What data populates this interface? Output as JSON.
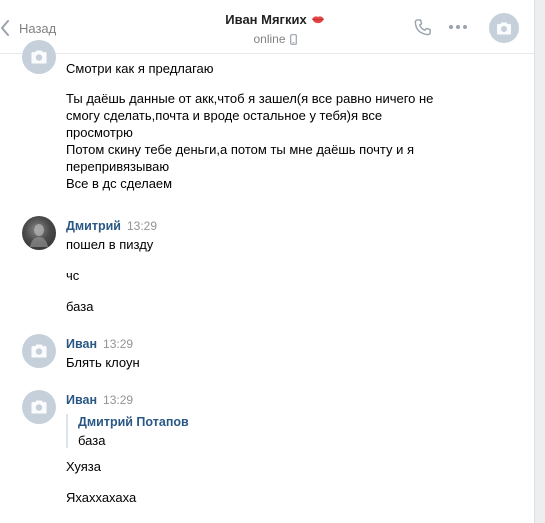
{
  "header": {
    "back_label": "Назад",
    "title": "Иван Мягких",
    "status": "online"
  },
  "messages": [
    {
      "lines": [
        "Смотри как я предлагаю",
        "Ты даёшь данные от акк,чтоб я зашел(я все равно ничего не\nсмогу сделать,почта и вроде остальное у тебя)я все\nпросмотрю\nПотом скину тебе деньги,а потом ты мне даёшь почту и я\nперепривязываю\nВсе в дс сделаем"
      ]
    },
    {
      "author": "Дмитрий",
      "time": "13:29",
      "lines": [
        "пошел в пизду",
        "чс",
        "база"
      ]
    },
    {
      "author": "Иван",
      "time": "13:29",
      "lines": [
        "Блять клоун"
      ]
    },
    {
      "author": "Иван",
      "time": "13:29",
      "quote": {
        "author": "Дмитрий Потапов",
        "text": "база"
      },
      "lines": [
        "Хуяза",
        "Яхаххахаха"
      ]
    }
  ],
  "colors": {
    "link_blue": "#2a5885",
    "secondary_gray": "#828282",
    "avatar_placeholder": "#c5d0db",
    "icon_blue": "#99a2ad"
  },
  "icons": [
    "chevron-left-icon",
    "lips-icon",
    "mobile-phone-icon",
    "phone-icon",
    "more-dots-icon",
    "camera-icon"
  ]
}
